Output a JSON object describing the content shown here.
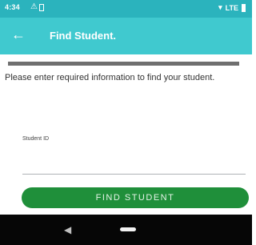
{
  "status_bar": {
    "time": "4:34",
    "network_text": "LTE"
  },
  "app_bar": {
    "title": "Find Student."
  },
  "progress": {
    "value": 1.0
  },
  "content": {
    "instruction": "Please enter required information to find your student.",
    "student_id_label": "Student ID",
    "student_id_value": "",
    "student_id_placeholder": ""
  },
  "actions": {
    "find_label": "FIND STUDENT"
  },
  "icons": {
    "back": "back-arrow-icon",
    "nav_back": "nav-back-icon",
    "nav_home": "nav-home-icon"
  },
  "colors": {
    "status_bar": "#2bb3bd",
    "app_bar": "#40c9cf",
    "button": "#1f8f3a",
    "nav_bar": "#060606"
  }
}
